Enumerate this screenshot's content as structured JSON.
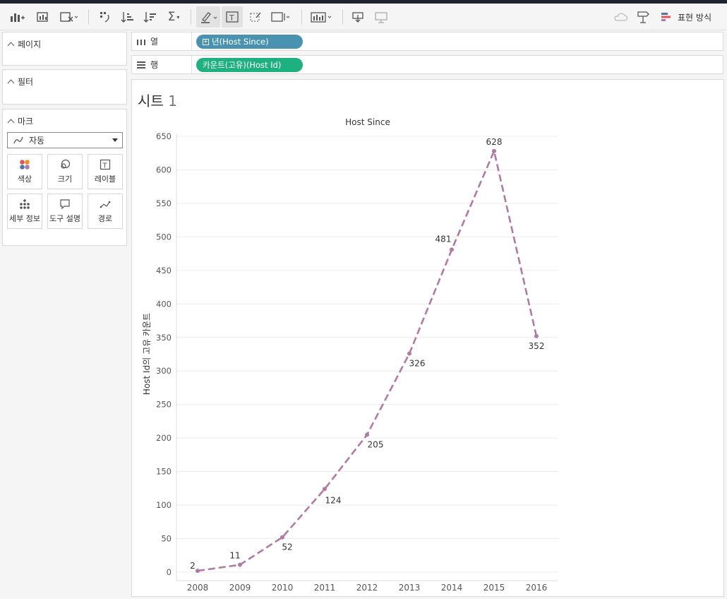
{
  "toolbar": {
    "icons": [
      "new-datasource-icon",
      "new-worksheet-icon",
      "clear-sheet-icon",
      "swap-icon",
      "sort-ascending-icon",
      "sort-descending-icon",
      "totals-icon",
      "highlight-icon",
      "labels-icon",
      "group-icon",
      "fit-icon",
      "show-me-icon",
      "download-icon",
      "presentation-icon",
      "cloud-icon",
      "signpost-icon",
      "present-icon"
    ],
    "present_label": "표현 방식"
  },
  "panels": {
    "pages_label": "페이지",
    "filters_label": "필터",
    "marks_label": "마크",
    "mark_type": "자동",
    "mark_cards": [
      "색상",
      "크기",
      "레이블",
      "세부 정보",
      "도구 설명",
      "경로"
    ]
  },
  "shelves": {
    "columns_label": "열",
    "rows_label": "행",
    "columns_pill": "년(Host Since)",
    "rows_pill": "카운트(고유)(Host Id)"
  },
  "sheet": {
    "title_text": "시트",
    "title_num": "1"
  },
  "colors": {
    "line": "#b07aa1",
    "columns_pill": "#4a93b0",
    "rows_pill": "#1fb07f"
  },
  "chart_data": {
    "type": "line",
    "title": "Host Since",
    "ylabel": "Host Id의 고유 카운트",
    "xlabel": "",
    "categories": [
      "2008",
      "2009",
      "2010",
      "2011",
      "2012",
      "2013",
      "2014",
      "2015",
      "2016"
    ],
    "values": [
      2,
      11,
      52,
      124,
      205,
      326,
      481,
      628,
      352
    ],
    "data_labels": [
      "2",
      "11",
      "52",
      "124",
      "205",
      "326",
      "481",
      "628",
      "352"
    ],
    "yticks": [
      0,
      50,
      100,
      150,
      200,
      250,
      300,
      350,
      400,
      450,
      500,
      550,
      600,
      650
    ],
    "ylim": [
      0,
      650
    ],
    "grid": true,
    "line_style": "dashed"
  }
}
